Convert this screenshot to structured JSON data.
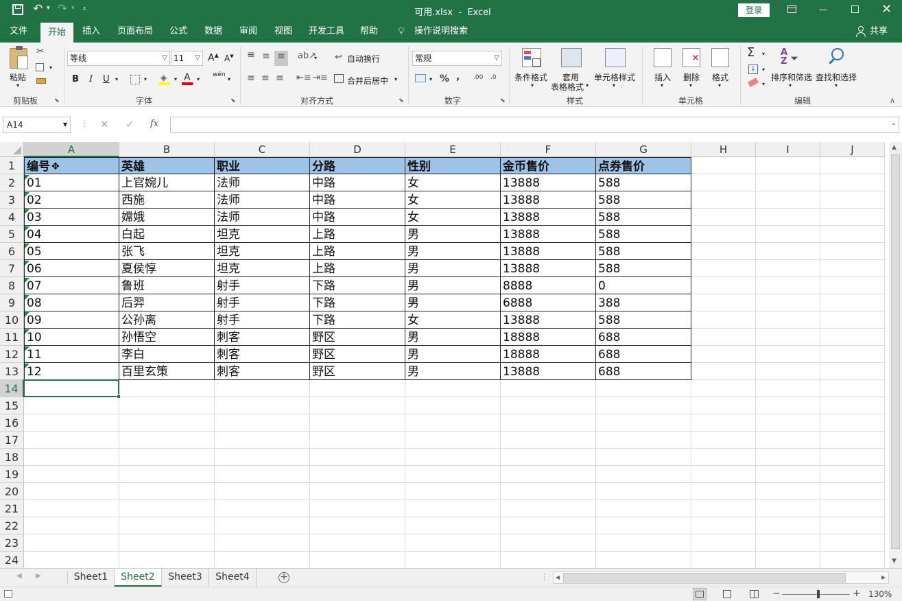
{
  "window": {
    "title": "可用.xlsx  -  Excel",
    "login_label": "登录",
    "qat_more": "="
  },
  "menu": {
    "tabs": [
      "文件",
      "开始",
      "插入",
      "页面布局",
      "公式",
      "数据",
      "审阅",
      "视图",
      "开发工具",
      "帮助"
    ],
    "tell_me": "操作说明搜索",
    "share": "共享"
  },
  "ribbon": {
    "clipboard": {
      "paste": "粘贴",
      "group": "剪贴板"
    },
    "font": {
      "name": "等线",
      "size": "11",
      "bold": "B",
      "italic": "I",
      "underline": "U",
      "group": "字体",
      "grow": "A",
      "shrink": "A",
      "phonetic": "wén"
    },
    "alignment": {
      "wrap": "自动换行",
      "merge": "合并后居中",
      "group": "对齐方式"
    },
    "number": {
      "format": "常规",
      "percent": "%",
      "comma": ",",
      "inc_dec": ".00",
      "dec_dec": ".0",
      "group": "数字"
    },
    "styles": {
      "conditional": "条件格式",
      "table_line1": "套用",
      "table_line2": "表格格式",
      "cell_styles": "单元格样式",
      "group": "样式"
    },
    "cells": {
      "insert": "插入",
      "delete": "删除",
      "format": "格式",
      "group": "单元格"
    },
    "editing": {
      "sort": "排序和筛选",
      "find": "查找和选择",
      "group": "编辑"
    }
  },
  "formula_bar": {
    "name_box": "A14",
    "fx": "fx",
    "value": ""
  },
  "grid": {
    "columns": [
      "A",
      "B",
      "C",
      "D",
      "E",
      "F",
      "G",
      "H",
      "I",
      "J"
    ],
    "rows": [
      "1",
      "2",
      "3",
      "4",
      "5",
      "6",
      "7",
      "8",
      "9",
      "10",
      "11",
      "12",
      "13",
      "14",
      "15",
      "16",
      "17",
      "18",
      "19",
      "20",
      "21",
      "22",
      "23",
      "24"
    ],
    "header": [
      "编号",
      "英雄",
      "职业",
      "分路",
      "性别",
      "金币售价",
      "点券售价"
    ],
    "data": [
      [
        "01",
        "上官婉儿",
        "法师",
        "中路",
        "女",
        "13888",
        "588"
      ],
      [
        "02",
        "西施",
        "法师",
        "中路",
        "女",
        "13888",
        "588"
      ],
      [
        "03",
        "嫦娥",
        "法师",
        "中路",
        "女",
        "13888",
        "588"
      ],
      [
        "04",
        "白起",
        "坦克",
        "上路",
        "男",
        "13888",
        "588"
      ],
      [
        "05",
        "张飞",
        "坦克",
        "上路",
        "男",
        "13888",
        "588"
      ],
      [
        "06",
        "夏侯惇",
        "坦克",
        "上路",
        "男",
        "13888",
        "588"
      ],
      [
        "07",
        "鲁班",
        "射手",
        "下路",
        "男",
        "8888",
        "0"
      ],
      [
        "08",
        "后羿",
        "射手",
        "下路",
        "男",
        "6888",
        "388"
      ],
      [
        "09",
        "公孙离",
        "射手",
        "下路",
        "女",
        "13888",
        "588"
      ],
      [
        "10",
        "孙悟空",
        "刺客",
        "野区",
        "男",
        "18888",
        "688"
      ],
      [
        "11",
        "李白",
        "刺客",
        "野区",
        "男",
        "18888",
        "688"
      ],
      [
        "12",
        "百里玄策",
        "刺客",
        "野区",
        "男",
        "13888",
        "688"
      ]
    ],
    "selected_cell": "A14",
    "header_fill": "#9dc3e6",
    "accent": "#217346"
  },
  "sheets": {
    "tabs": [
      "Sheet1",
      "Sheet2",
      "Sheet3",
      "Sheet4"
    ],
    "active": "Sheet2"
  },
  "status": {
    "zoom": "130%",
    "zoom_minus": "−",
    "zoom_plus": "+"
  }
}
